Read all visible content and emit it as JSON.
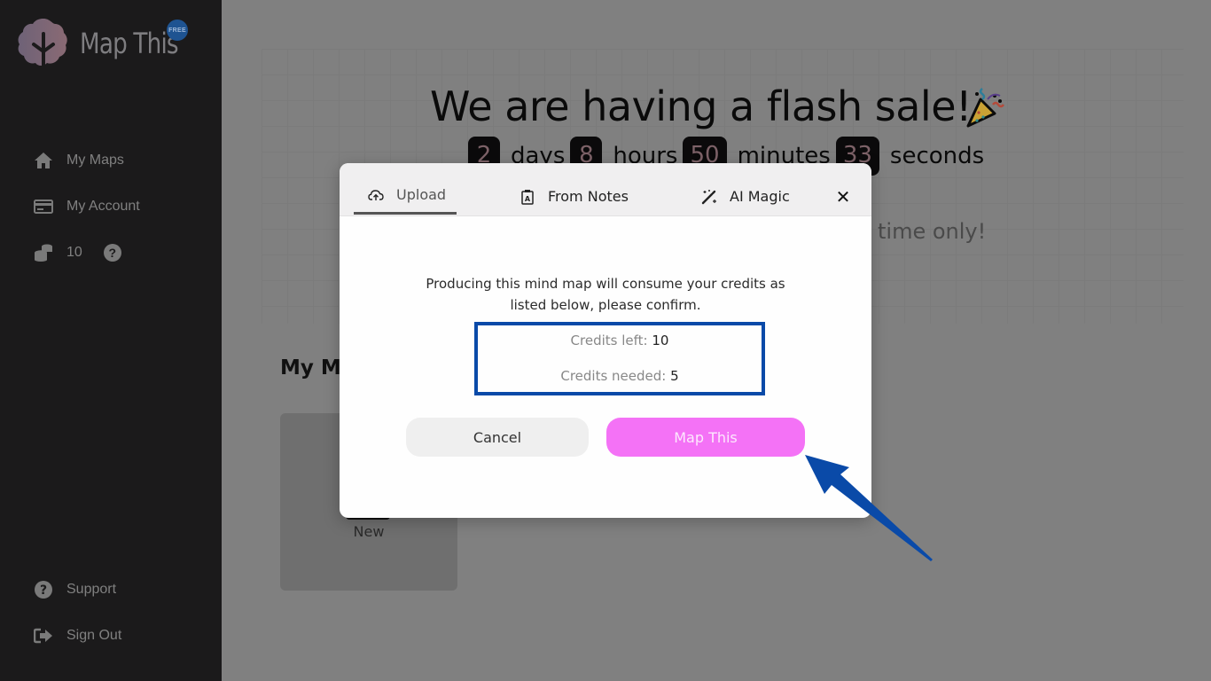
{
  "app": {
    "name": "Map This",
    "badge": "FREE",
    "brand_color": "#f472f6"
  },
  "sidebar": {
    "items": [
      {
        "label": "My Maps",
        "icon": "home-icon"
      },
      {
        "label": "My Account",
        "icon": "credit-card-icon"
      }
    ],
    "credits": {
      "value": "10",
      "icon": "coins-icon",
      "help_icon": "question-circle-icon"
    },
    "bottom_items": [
      {
        "label": "Support",
        "icon": "question-circle-icon"
      },
      {
        "label": "Sign Out",
        "icon": "sign-out-icon"
      }
    ]
  },
  "banner": {
    "title": "We are having a flash sale!",
    "title_icon": "party-popper-icon",
    "countdown": [
      {
        "value": "2",
        "unit": "days"
      },
      {
        "value": "8",
        "unit": "hours"
      },
      {
        "value": "50",
        "unit": "minutes"
      },
      {
        "value": "33",
        "unit": "seconds"
      }
    ],
    "subtitle_visible": "time only!"
  },
  "main": {
    "section_title": "My Mi",
    "new_card_label": "New"
  },
  "modal": {
    "tabs": [
      {
        "label": "Upload",
        "icon": "cloud-upload-icon",
        "active": true
      },
      {
        "label": "From Notes",
        "icon": "clipboard-icon",
        "active": false
      },
      {
        "label": "AI Magic",
        "icon": "magic-wand-icon",
        "active": false
      }
    ],
    "close_label": "✕",
    "message": "Producing this mind map will consume your credits as listed below, please confirm.",
    "credits_left_label": "Credits left:",
    "credits_left_value": "10",
    "credits_needed_label": "Credits needed:",
    "credits_needed_value": "5",
    "cancel_label": "Cancel",
    "confirm_label": "Map This",
    "highlight_color": "#0a4aa8"
  }
}
